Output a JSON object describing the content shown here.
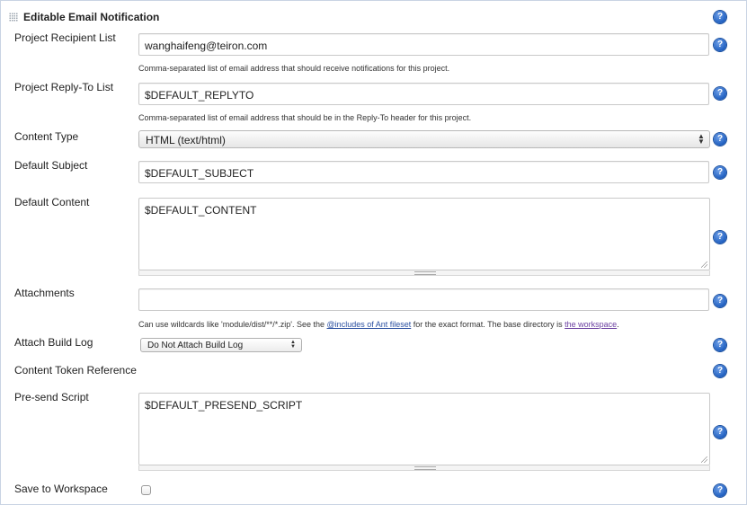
{
  "section": {
    "title": "Editable Email Notification"
  },
  "fields": {
    "recipient": {
      "label": "Project Recipient List",
      "value": "wanghaifeng@teiron.com",
      "hint": "Comma-separated list of email address that should receive notifications for this project."
    },
    "reply_to": {
      "label": "Project Reply-To List",
      "value": "$DEFAULT_REPLYTO",
      "hint": "Comma-separated list of email address that should be in the Reply-To header for this project."
    },
    "content_type": {
      "label": "Content Type",
      "selected": "HTML (text/html)"
    },
    "subject": {
      "label": "Default Subject",
      "value": "$DEFAULT_SUBJECT"
    },
    "content": {
      "label": "Default Content",
      "value": "$DEFAULT_CONTENT"
    },
    "attachments": {
      "label": "Attachments",
      "value": "",
      "hint_prefix": "Can use wildcards like 'module/dist/**/*.zip'. See the ",
      "hint_link1": "@includes of Ant fileset",
      "hint_middle": " for the exact format. The base directory is ",
      "hint_link2": "the workspace",
      "hint_suffix": "."
    },
    "attach_build_log": {
      "label": "Attach Build Log",
      "selected": "Do Not Attach Build Log"
    },
    "token_reference": {
      "label": "Content Token Reference"
    },
    "presend_script": {
      "label": "Pre-send Script",
      "value": "$DEFAULT_PRESEND_SCRIPT"
    },
    "save_to_workspace": {
      "label": "Save to Workspace",
      "checked": false
    }
  },
  "help_glyph": "?",
  "icons": {
    "help": "help-icon",
    "drag": "drag-handle-icon",
    "select_arrows": "select-arrows-icon",
    "resize": "resize-grip-icon"
  }
}
